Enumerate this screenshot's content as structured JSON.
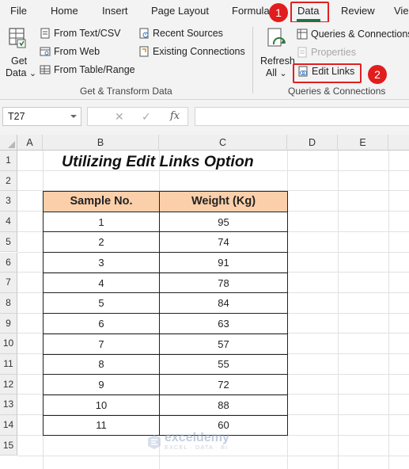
{
  "ribbon_tabs": [
    "File",
    "Home",
    "Insert",
    "Page Layout",
    "Formula",
    "Data",
    "Review",
    "Vie"
  ],
  "active_tab": "Data",
  "callouts": {
    "step1": "1",
    "step2": "2"
  },
  "get_data": {
    "line1": "Get",
    "line2": "Data",
    "caret": "⌄"
  },
  "get_transform": {
    "items": [
      "From Text/CSV",
      "From Web",
      "From Table/Range",
      "Recent Sources",
      "Existing Connections"
    ],
    "label": "Get & Transform Data"
  },
  "refresh": {
    "line1": "Refresh",
    "line2": "All",
    "caret": "⌄"
  },
  "queries": {
    "items": [
      "Queries & Connections",
      "Properties",
      "Edit Links"
    ],
    "label": "Queries & Connections"
  },
  "formula_bar": {
    "name_box": "T27",
    "fx": "fx",
    "cancel": "✕",
    "enter": "✓"
  },
  "columns": [
    "A",
    "B",
    "C",
    "D",
    "E"
  ],
  "rows": [
    "1",
    "2",
    "3",
    "4",
    "5",
    "6",
    "7",
    "8",
    "9",
    "10",
    "11",
    "12",
    "13",
    "14",
    "15"
  ],
  "sheet": {
    "title": "Utilizing Edit Links Option",
    "headers": [
      "Sample No.",
      "Weight (Kg)"
    ],
    "records": [
      [
        "1",
        "95"
      ],
      [
        "2",
        "74"
      ],
      [
        "3",
        "91"
      ],
      [
        "4",
        "78"
      ],
      [
        "5",
        "84"
      ],
      [
        "6",
        "63"
      ],
      [
        "7",
        "57"
      ],
      [
        "8",
        "55"
      ],
      [
        "9",
        "72"
      ],
      [
        "10",
        "88"
      ],
      [
        "11",
        "60"
      ]
    ]
  },
  "watermark": {
    "name": "exceldemy",
    "tagline": "EXCEL · DATA · BI"
  },
  "colors": {
    "accent": "#217346",
    "callout": "#e21d1d",
    "header_fill": "#fbcfaa"
  }
}
